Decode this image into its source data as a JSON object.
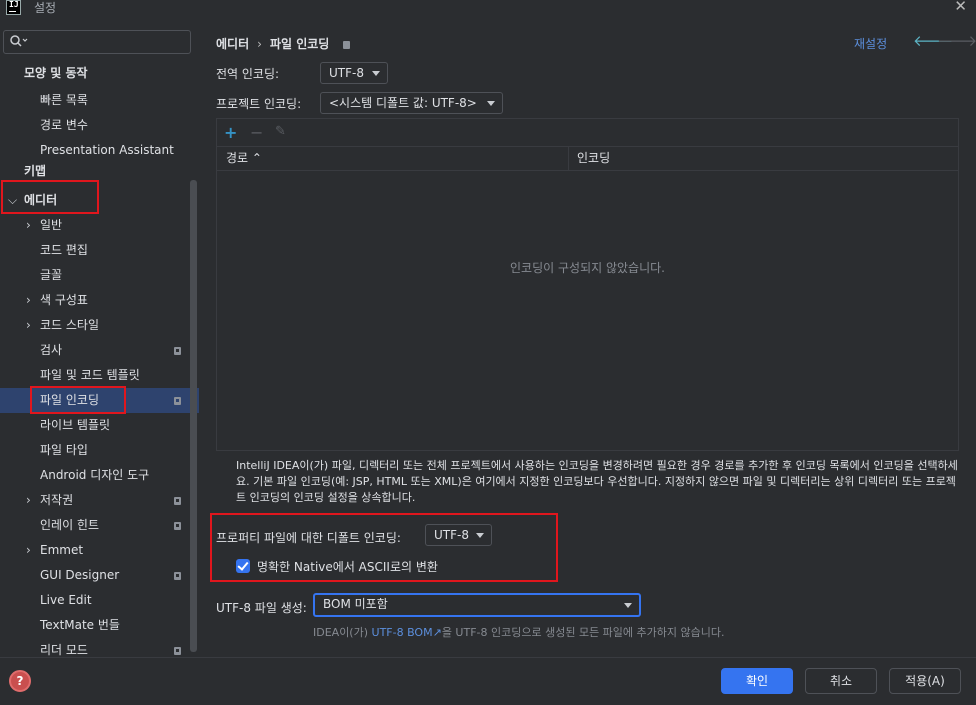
{
  "window": {
    "title": "설정",
    "close_glyph": "✕"
  },
  "sidebar": {
    "search_placeholder": "",
    "items": [
      {
        "label": "모양 및 동작"
      },
      {
        "label": "빠른 목록"
      },
      {
        "label": "경로 변수"
      },
      {
        "label": "Presentation Assistant"
      },
      {
        "label": "키맵"
      },
      {
        "label": "에디터"
      },
      {
        "label": "일반"
      },
      {
        "label": "코드 편집"
      },
      {
        "label": "글꼴"
      },
      {
        "label": "색 구성표"
      },
      {
        "label": "코드 스타일"
      },
      {
        "label": "검사"
      },
      {
        "label": "파일 및 코드 템플릿"
      },
      {
        "label": "파일 인코딩"
      },
      {
        "label": "라이브 템플릿"
      },
      {
        "label": "파일 타입"
      },
      {
        "label": "Android 디자인 도구"
      },
      {
        "label": "저작권"
      },
      {
        "label": "인레이 힌트"
      },
      {
        "label": "Emmet"
      },
      {
        "label": "GUI Designer"
      },
      {
        "label": "Live Edit"
      },
      {
        "label": "TextMate 번들"
      },
      {
        "label": "리더 모드"
      }
    ]
  },
  "content": {
    "breadcrumb": {
      "parent": "에디터",
      "separator": "›",
      "current": "파일 인코딩"
    },
    "reset_label": "재설정",
    "global_encoding": {
      "label": "전역 인코딩:",
      "value": "UTF-8"
    },
    "project_encoding": {
      "label": "프로젝트 인코딩:",
      "value": "<시스템 디폴트 값: UTF-8>"
    },
    "table": {
      "add_glyph": "+",
      "remove_glyph": "−",
      "edit_glyph": "✎",
      "col_path": "경로",
      "sort_glyph": "⌃",
      "col_encoding": "인코딩",
      "empty_text": "인코딩이 구성되지 않았습니다."
    },
    "description": "IntelliJ IDEA이(가) 파일, 디렉터리 또는 전체 프로젝트에서 사용하는 인코딩을 변경하려면 필요한 경우 경로를 추가한 후 인코딩 목록에서 인코딩을 선택하세요. 기본 파일 인코딩(예: JSP, HTML 또는 XML)은 여기에서 지정한 인코딩보다 우선합니다. 지정하지 않으면 파일 및 디렉터리는 상위 디렉터리 또는 프로젝트 인코딩의 인코딩 설정을 상속합니다.",
    "properties_encoding": {
      "label": "프로퍼티 파일에 대한 디폴트 인코딩:",
      "value": "UTF-8"
    },
    "native_ascii": {
      "label": "명확한 Native에서 ASCII로의 변환",
      "checked": true
    },
    "bom": {
      "label": "UTF-8 파일 생성:",
      "value": "BOM 미포함"
    },
    "hint": {
      "prefix": "IDEA이(가) ",
      "link": "UTF-8 BOM",
      "link_icon": "↗",
      "suffix": "을 UTF-8 인코딩으로 생성된 모든 파일에 추가하지 않습니다."
    }
  },
  "footer": {
    "help_glyph": "?",
    "ok_label": "확인",
    "cancel_label": "취소",
    "apply_label": "적용(A)"
  },
  "colors": {
    "accent": "#3574f0",
    "selection": "#2e436e",
    "link": "#5c8fdd",
    "highlight": "#e0161d"
  }
}
